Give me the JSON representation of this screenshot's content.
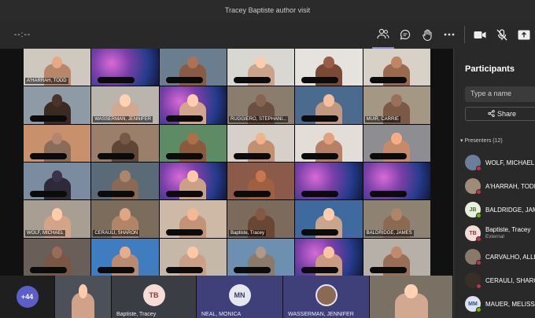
{
  "window": {
    "title": "Tracey Baptiste author visit"
  },
  "toolbar": {
    "timer": "--:--",
    "icons": [
      "people-icon",
      "chat-icon",
      "raise-hand-icon",
      "more-icon",
      "camera-icon",
      "mic-off-icon",
      "share-tray-icon"
    ]
  },
  "tiles": [
    {
      "label": "A'HARRAH, TODD",
      "bg": "#cfc8bf",
      "skin": "#b8866a"
    },
    {
      "label": "",
      "bg": "galaxy"
    },
    {
      "label": "",
      "bg": "#6a7e90",
      "skin": "#8a5b44"
    },
    {
      "label": "",
      "bg": "#d9d7d2",
      "skin": "#c9a38a"
    },
    {
      "label": "",
      "bg": "#e6e2dd",
      "skin": "#7a4a36"
    },
    {
      "label": "",
      "bg": "#d8d1c8",
      "skin": "#9a6a50"
    },
    {
      "label": "",
      "bg": "#8e9aa6",
      "skin": "#3b2a22"
    },
    {
      "label": "WASSERMAN, JENNIFER",
      "bg": "#b9b5ad",
      "skin": "#d2a88f"
    },
    {
      "label": "",
      "bg": "galaxy",
      "skin": "#d3a58d"
    },
    {
      "label": "RUGGIERO, STEPHANI...",
      "bg": "#8b7d6e",
      "skin": "#6a5040"
    },
    {
      "label": "",
      "bg": "#4a6b8e",
      "skin": "#c39880"
    },
    {
      "label": "MUIR, CARRIE",
      "bg": "#a49784",
      "skin": "#7a5a46"
    },
    {
      "label": "",
      "bg": "#c8916b",
      "skin": "#8b6c58"
    },
    {
      "label": "",
      "bg": "#9a7f6a",
      "skin": "#5e4636"
    },
    {
      "label": "",
      "bg": "#5d8c64",
      "skin": "#8b5a3c"
    },
    {
      "label": "",
      "bg": "#d6d0c8",
      "skin": "#c09070"
    },
    {
      "label": "",
      "bg": "#e2ddd7",
      "skin": "#b58066"
    },
    {
      "label": "",
      "bg": "#8e8e92",
      "skin": "#c48a6a"
    },
    {
      "label": "",
      "bg": "#7b8ca0",
      "skin": "#2f2a3a"
    },
    {
      "label": "",
      "bg": "#5b6a77",
      "skin": "#8a6a55"
    },
    {
      "label": "",
      "bg": "galaxy",
      "skin": "#caa086"
    },
    {
      "label": "",
      "bg": "#8c5a48",
      "skin": "#a06040"
    },
    {
      "label": "",
      "bg": "galaxy"
    },
    {
      "label": "",
      "bg": "galaxy"
    },
    {
      "label": "WOLF, MICHAEL",
      "bg": "#a89f92",
      "skin": "#d4a488"
    },
    {
      "label": "CERAULI, SHARON",
      "bg": "#7c6c5b",
      "skin": "#b28569"
    },
    {
      "label": "",
      "bg": "#cdb9a6",
      "skin": "#c39377"
    },
    {
      "label": "Baptiste, Tracey",
      "bg": "#7c6a5b",
      "skin": "#6a4634"
    },
    {
      "label": "",
      "bg": "#3e6aa0",
      "skin": "#c9a58c"
    },
    {
      "label": "BALDRIDGE, JAMES",
      "bg": "#8e8373",
      "skin": "#8b6a52"
    },
    {
      "label": "",
      "bg": "#6a5f58",
      "skin": "#7a5646"
    },
    {
      "label": "",
      "bg": "#3f7cc0",
      "skin": "#b88a70"
    },
    {
      "label": "",
      "bg": "#c5b8a8",
      "skin": "#caa086"
    },
    {
      "label": "",
      "bg": "#6d8fb0",
      "skin": "#8a7a6a"
    },
    {
      "label": "",
      "bg": "galaxy",
      "skin": "#c79c83"
    },
    {
      "label": "",
      "bg": "#b7b0a8",
      "skin": "#9a6e56"
    }
  ],
  "bottom": [
    {
      "kind": "count",
      "text": "+44"
    },
    {
      "kind": "photo",
      "label": "",
      "bg": "#4c5058",
      "skin": "#d0a28a"
    },
    {
      "kind": "avatar",
      "initials": "TB",
      "label": "Baptiste, Tracey",
      "bg": "#3b3d44",
      "color": "#f6dcd6",
      "textColor": "#8a3a3a"
    },
    {
      "kind": "avatar",
      "initials": "MN",
      "label": "NEAL, MONICA",
      "bg": "#3f3f7a",
      "color": "#e6e6ef",
      "textColor": "#3a3a66"
    },
    {
      "kind": "avatarphoto",
      "label": "WASSERMAN, JENNIFER",
      "bg": "#3f3f7a"
    },
    {
      "kind": "photo",
      "label": "",
      "bg": "#7a7064",
      "skin": "#d2a890"
    }
  ],
  "panel": {
    "title": "Participants",
    "search_placeholder": "Type a name",
    "share_label": "Share",
    "section": "Presenters (12)",
    "participants": [
      {
        "name": "WOLF, MICHAEL",
        "sub": "",
        "initials": "",
        "avatar_color": "#6b7f9a",
        "status": "#c4314b"
      },
      {
        "name": "A'HARRAH, TODD",
        "sub": "",
        "initials": "",
        "avatar_color": "#a08a78",
        "status": "#c4314b"
      },
      {
        "name": "BALDRIDGE, JAMES",
        "sub": "",
        "initials": "JB",
        "avatar_color": "#e7f0dc",
        "text_color": "#4a6a2a",
        "status": "#6bb700"
      },
      {
        "name": "Baptiste, Tracey",
        "sub": "External",
        "initials": "TB",
        "avatar_color": "#f6dcd6",
        "text_color": "#8a3a3a",
        "status": "#c4314b"
      },
      {
        "name": "CARVALHO, ALLISON",
        "sub": "",
        "initials": "",
        "avatar_color": "#8a7868",
        "status": "#c4314b"
      },
      {
        "name": "CERAULI, SHARON",
        "sub": "",
        "initials": "",
        "avatar_color": "#3a2e28",
        "status": "#c4314b"
      },
      {
        "name": "MAUER, MELISSA",
        "sub": "",
        "initials": "MM",
        "avatar_color": "#dbe3f2",
        "text_color": "#3a4a7a",
        "status": "#6bb700"
      }
    ]
  }
}
